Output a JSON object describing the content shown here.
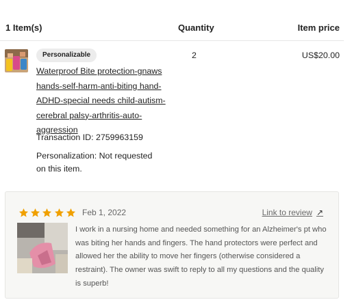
{
  "header": {
    "items_label": "1 Item(s)",
    "quantity_label": "Quantity",
    "item_price_label": "Item price"
  },
  "item": {
    "badge": "Personalizable",
    "title": "Waterproof Bite protection-gnaws hands-self-harm-anti-biting hand-ADHD-special needs child-autism-cerebral palsy-arthritis-auto-aggression",
    "transaction": "Transaction ID: 2759963159",
    "personalization": "Personalization: Not requested on this item.",
    "quantity": "2",
    "price": "US$20.00"
  },
  "review": {
    "rating": 5,
    "star_color": "#f0a000",
    "date": "Feb 1, 2022",
    "link_label": "Link to review",
    "link_icon": "arrow-up-right-icon",
    "text": "I work in a nursing home and needed something for an Alzheimer's pt who was biting her hands and fingers. The hand protectors were perfect and allowed her the ability to move her fingers (otherwise considered a restraint). The owner was swift to reply to all my questions and the quality is superb!"
  }
}
